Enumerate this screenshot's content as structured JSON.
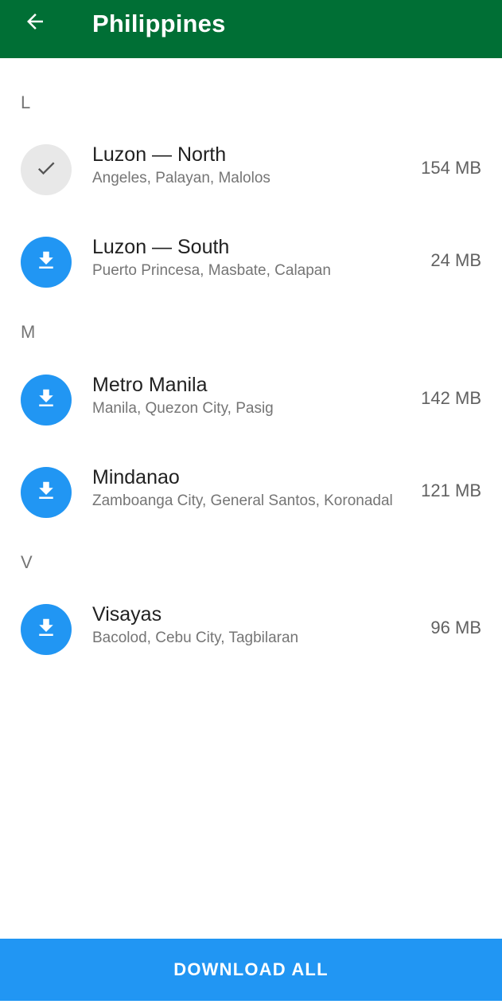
{
  "toolbar": {
    "title": "Philippines",
    "back_icon": "arrow-left-icon",
    "background_color": "#006f35"
  },
  "sections": [
    {
      "letter": "L",
      "items": [
        {
          "name": "Luzon — North",
          "cities": "Angeles, Palayan, Malolos",
          "size": "154 MB",
          "status": "downloaded",
          "icon": "check-icon"
        },
        {
          "name": "Luzon — South",
          "cities": "Puerto Princesa, Masbate, Calapan",
          "size": "24 MB",
          "status": "not-downloaded",
          "icon": "download-icon"
        }
      ]
    },
    {
      "letter": "M",
      "items": [
        {
          "name": "Metro Manila",
          "cities": "Manila, Quezon City, Pasig",
          "size": "142 MB",
          "status": "not-downloaded",
          "icon": "download-icon"
        },
        {
          "name": "Mindanao",
          "cities": "Zamboanga City, General Santos, Koronadal",
          "size": "121 MB",
          "status": "not-downloaded",
          "icon": "download-icon"
        }
      ]
    },
    {
      "letter": "V",
      "items": [
        {
          "name": "Visayas",
          "cities": "Bacolod, Cebu City, Tagbilaran",
          "size": "96 MB",
          "status": "not-downloaded",
          "icon": "download-icon"
        }
      ]
    }
  ],
  "footer": {
    "download_all_label": "DOWNLOAD ALL",
    "button_color": "#2196f3"
  },
  "colors": {
    "accent_blue": "#2196f3",
    "downloaded_gray": "#e8e8e8"
  }
}
